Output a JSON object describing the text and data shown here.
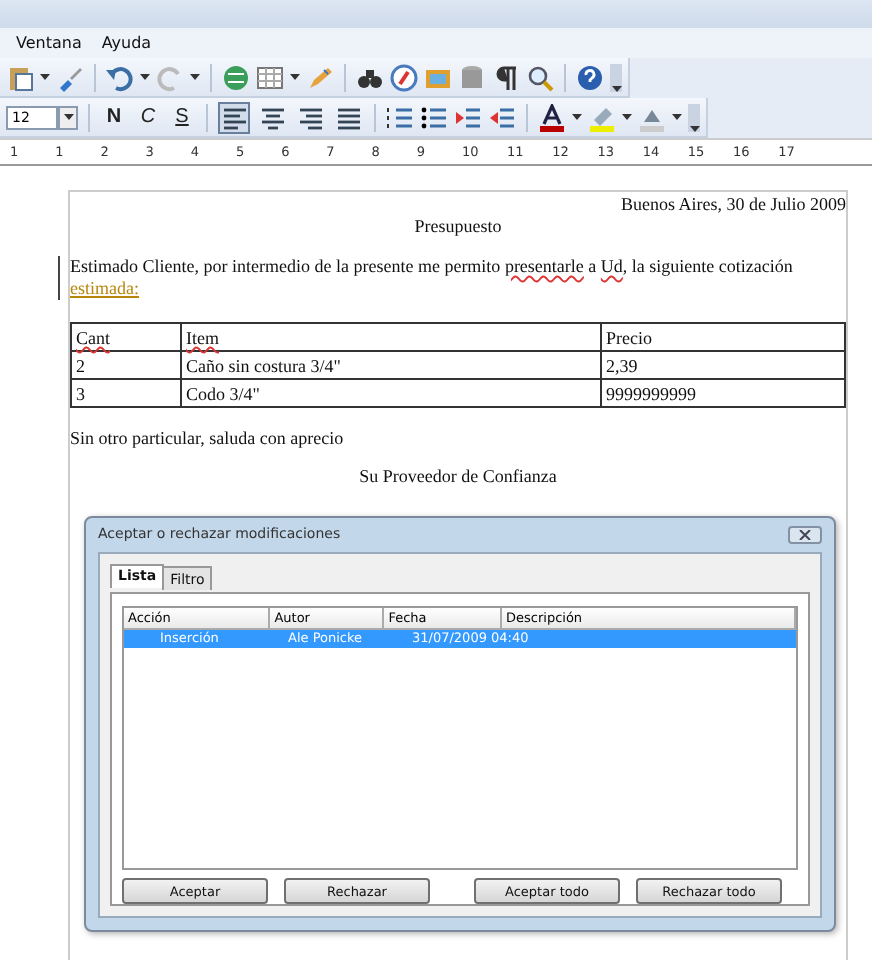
{
  "menu": [
    {
      "label": "Ventana"
    },
    {
      "label": "Ayuda"
    }
  ],
  "format_toolbar": {
    "font_size": "12",
    "style_buttons": [
      {
        "label": "N",
        "kind": "bold"
      },
      {
        "label": "C",
        "kind": "italic"
      },
      {
        "label": "S",
        "kind": "underline"
      }
    ],
    "alignment": [
      {
        "kind": "left",
        "selected": true
      },
      {
        "kind": "center",
        "selected": false
      },
      {
        "kind": "right",
        "selected": false
      },
      {
        "kind": "justify",
        "selected": false
      }
    ]
  },
  "ruler": {
    "labels": [
      "1",
      "1",
      "2",
      "3",
      "4",
      "5",
      "6",
      "7",
      "8",
      "9",
      "10",
      "11",
      "12",
      "13",
      "14",
      "15",
      "16",
      "17"
    ]
  },
  "document": {
    "date": "Buenos Aires, 30 de Julio 2009",
    "title": "Presupuesto",
    "paragraph": [
      {
        "text": "Estimado Cliente, por intermedio de la presente me permito ",
        "kind": "plain"
      },
      {
        "text": "presentarle",
        "kind": "misspelled"
      },
      {
        "text": " a ",
        "kind": "plain"
      },
      {
        "text": "Ud",
        "kind": "misspelled"
      },
      {
        "text": ", la siguiente cotización ",
        "kind": "plain"
      },
      {
        "text": "estimada",
        "kind": "inserted"
      },
      {
        "text": ":",
        "kind": "inserted"
      }
    ],
    "table": {
      "columns": [
        {
          "text": "Cant",
          "misspelled": true
        },
        {
          "text": "Item",
          "misspelled": true
        },
        {
          "text": "Precio",
          "misspelled": false
        }
      ],
      "rows": [
        [
          "2",
          "Caño sin costura 3/4\"",
          "2,39"
        ],
        [
          "3",
          "Codo 3/4\"",
          "9999999999"
        ]
      ]
    },
    "closing": "Sin otro particular, saluda con aprecio",
    "signature": "Su Proveedor de Confianza"
  },
  "dialog": {
    "title": "Aceptar o rechazar modificaciones",
    "tabs": [
      {
        "label": "Lista",
        "selected": true
      },
      {
        "label": "Filtro",
        "selected": false
      }
    ],
    "columns": [
      "Acción",
      "Autor",
      "Fecha",
      "Descripción"
    ],
    "rows": [
      {
        "cells": [
          "Inserción",
          "Ale Ponicke",
          "31/07/2009 04:40"
        ],
        "selected": true
      }
    ],
    "buttons": [
      "Aceptar",
      "Rechazar",
      "Aceptar todo",
      "Rechazar todo"
    ]
  }
}
